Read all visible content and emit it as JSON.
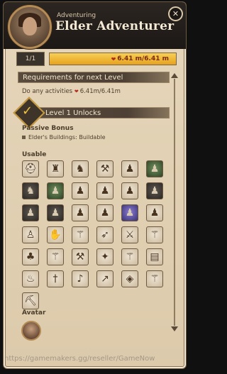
{
  "header": {
    "subtitle": "Adventuring",
    "title": "Elder Adventurer",
    "close_icon": "close-icon"
  },
  "progress": {
    "level_label": "1/1",
    "value_text": "6.41 m/6.41 m",
    "fraction": 1.0,
    "icon": "fame-icon"
  },
  "requirements": {
    "heading": "Requirements for next Level",
    "text_prefix": "Do any activities",
    "text_value": "6.41m/6.41m",
    "icon": "fame-icon"
  },
  "unlocks": {
    "heading": "Level 1 Unlocks",
    "badge_icon": "checkmark-icon",
    "passive_label": "Passive Bonus",
    "passive_items": [
      "Elder's Buildings: Buildable"
    ]
  },
  "usable": {
    "label": "Usable",
    "items": [
      {
        "icon": "helmet-icon",
        "tone": "light"
      },
      {
        "icon": "armor-icon",
        "tone": "light"
      },
      {
        "icon": "boots-icon",
        "tone": "light"
      },
      {
        "icon": "axe-icon",
        "tone": "light"
      },
      {
        "icon": "creature-icon",
        "tone": "light"
      },
      {
        "icon": "creature-icon",
        "tone": "green"
      },
      {
        "icon": "beast-icon",
        "tone": "dark"
      },
      {
        "icon": "creature-icon",
        "tone": "green"
      },
      {
        "icon": "creature-icon",
        "tone": "light"
      },
      {
        "icon": "creature-icon",
        "tone": "light"
      },
      {
        "icon": "creature-icon",
        "tone": "light"
      },
      {
        "icon": "creature-icon",
        "tone": "dark"
      },
      {
        "icon": "creature-icon",
        "tone": "dark"
      },
      {
        "icon": "creature-icon",
        "tone": "dark"
      },
      {
        "icon": "creature-icon",
        "tone": "light"
      },
      {
        "icon": "creature-icon",
        "tone": "light"
      },
      {
        "icon": "creature-icon",
        "tone": "blue"
      },
      {
        "icon": "creature-icon",
        "tone": "light"
      },
      {
        "icon": "hood-icon",
        "tone": "light"
      },
      {
        "icon": "gloves-icon",
        "tone": "light"
      },
      {
        "icon": "staff-icon",
        "tone": "light"
      },
      {
        "icon": "bow-icon",
        "tone": "light"
      },
      {
        "icon": "sword-icon",
        "tone": "light"
      },
      {
        "icon": "staff-icon",
        "tone": "light"
      },
      {
        "icon": "mace-icon",
        "tone": "light"
      },
      {
        "icon": "staff-icon",
        "tone": "light"
      },
      {
        "icon": "hammer-icon",
        "tone": "light"
      },
      {
        "icon": "wand-icon",
        "tone": "light"
      },
      {
        "icon": "staff-icon",
        "tone": "light"
      },
      {
        "icon": "book-icon",
        "tone": "light"
      },
      {
        "icon": "torch-icon",
        "tone": "light"
      },
      {
        "icon": "dagger-icon",
        "tone": "light"
      },
      {
        "icon": "horn-icon",
        "tone": "light"
      },
      {
        "icon": "spear-icon",
        "tone": "light"
      },
      {
        "icon": "shield-icon",
        "tone": "light"
      },
      {
        "icon": "staff-icon",
        "tone": "light"
      },
      {
        "icon": "pickaxe-icon",
        "tone": "light"
      }
    ]
  },
  "avatar": {
    "label": "Avatar",
    "icon": "avatar-portrait"
  },
  "watermark": "https://gamemakers.gg/reseller/GameNow"
}
